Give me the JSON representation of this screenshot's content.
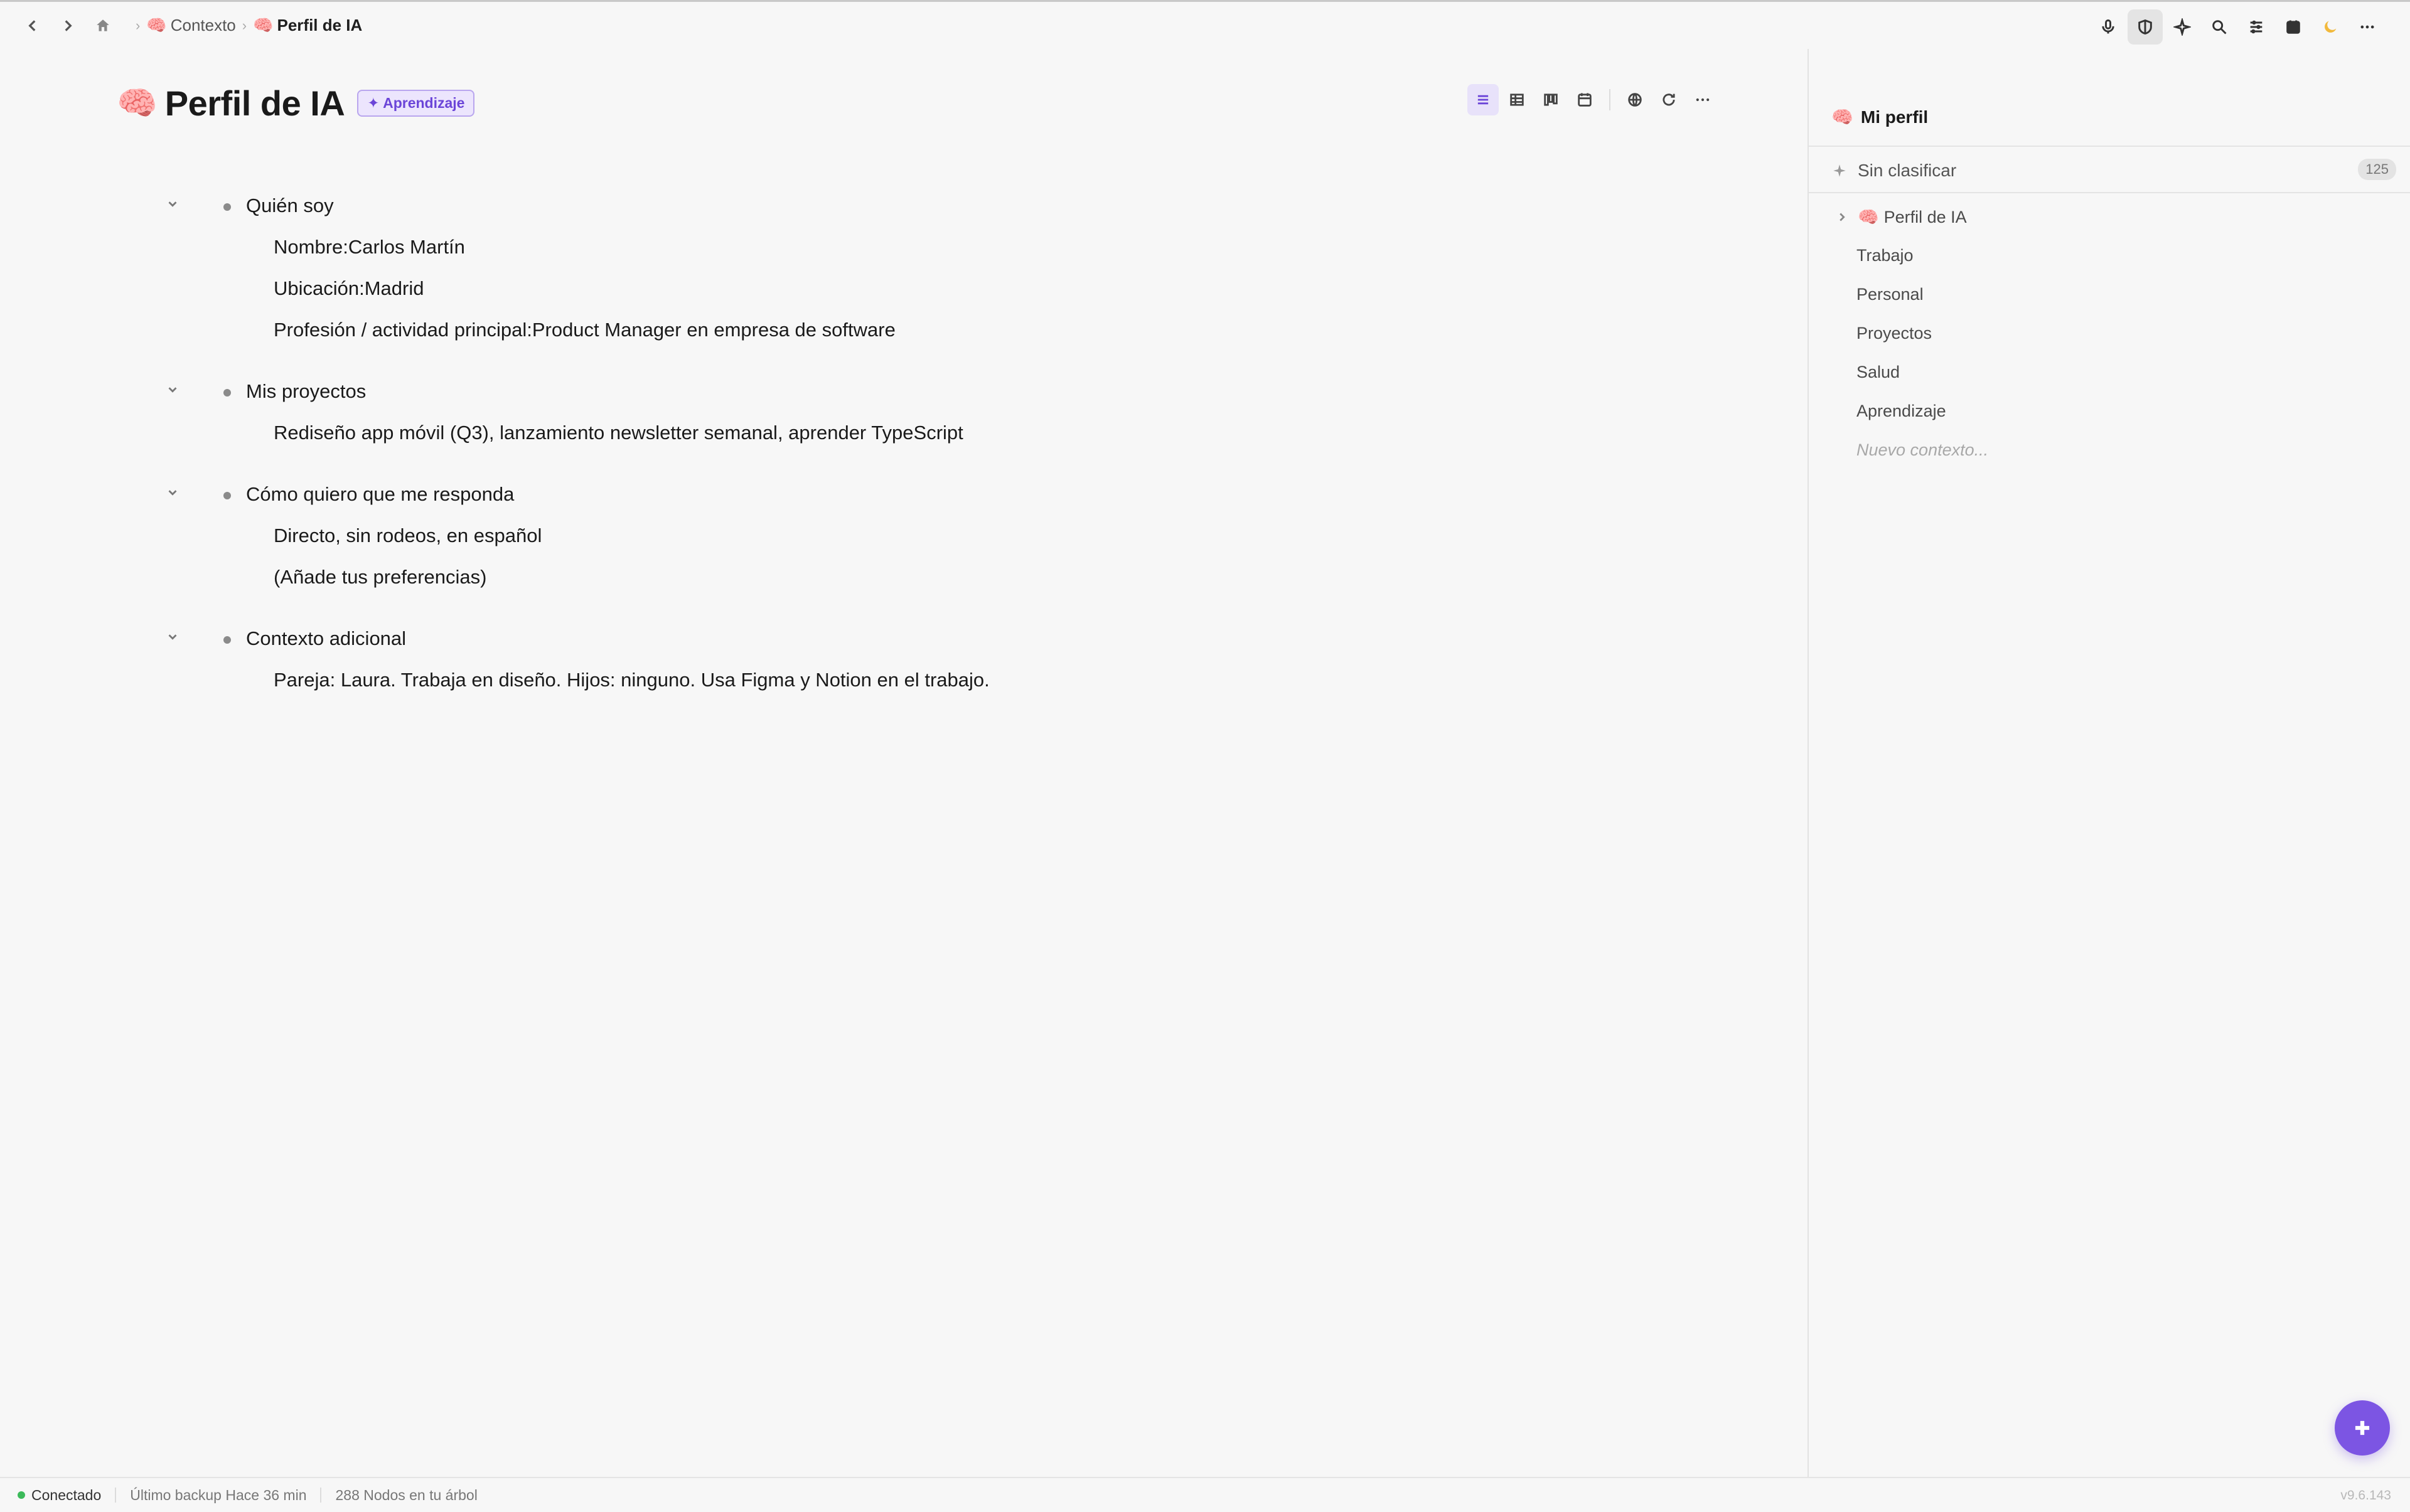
{
  "breadcrumb": {
    "items": [
      {
        "emoji": "🧠",
        "label": "Contexto"
      },
      {
        "emoji": "🧠",
        "label": "Perfil de IA"
      }
    ]
  },
  "page": {
    "emoji": "🧠",
    "title": "Perfil de IA",
    "tag": "✦ Aprendizaje"
  },
  "outline": {
    "sections": [
      {
        "heading": "Quién soy",
        "children": [
          "Nombre:Carlos Martín",
          "Ubicación:Madrid",
          "Profesión / actividad principal:Product Manager en empresa de software"
        ]
      },
      {
        "heading": "Mis proyectos",
        "children": [
          "Rediseño app móvil (Q3), lanzamiento newsletter semanal, aprender TypeScript"
        ]
      },
      {
        "heading": "Cómo quiero que me responda",
        "children": [
          "Directo, sin rodeos, en español",
          "(Añade tus preferencias)"
        ]
      },
      {
        "heading": "Contexto adicional",
        "children": [
          "Pareja: Laura. Trabaja en diseño. Hijos: ninguno. Usa Figma y Notion en el trabajo."
        ]
      }
    ]
  },
  "sidebar": {
    "header_emoji": "🧠",
    "header": "Mi perfil",
    "unclassified": {
      "label": "Sin clasificar",
      "count": "125"
    },
    "tree_item": {
      "emoji": "🧠",
      "label": "Perfil de IA"
    },
    "items": [
      "Trabajo",
      "Personal",
      "Proyectos",
      "Salud",
      "Aprendizaje"
    ],
    "new_placeholder": "Nuevo contexto..."
  },
  "status": {
    "connection": "Conectado",
    "backup": "Último backup Hace 36 min",
    "nodes": "288 Nodos en tu árbol",
    "version": "v9.6.143"
  },
  "colors": {
    "accent": "#7c55e3",
    "tag_bg": "#ece5fd",
    "connected": "#3cba5a"
  }
}
